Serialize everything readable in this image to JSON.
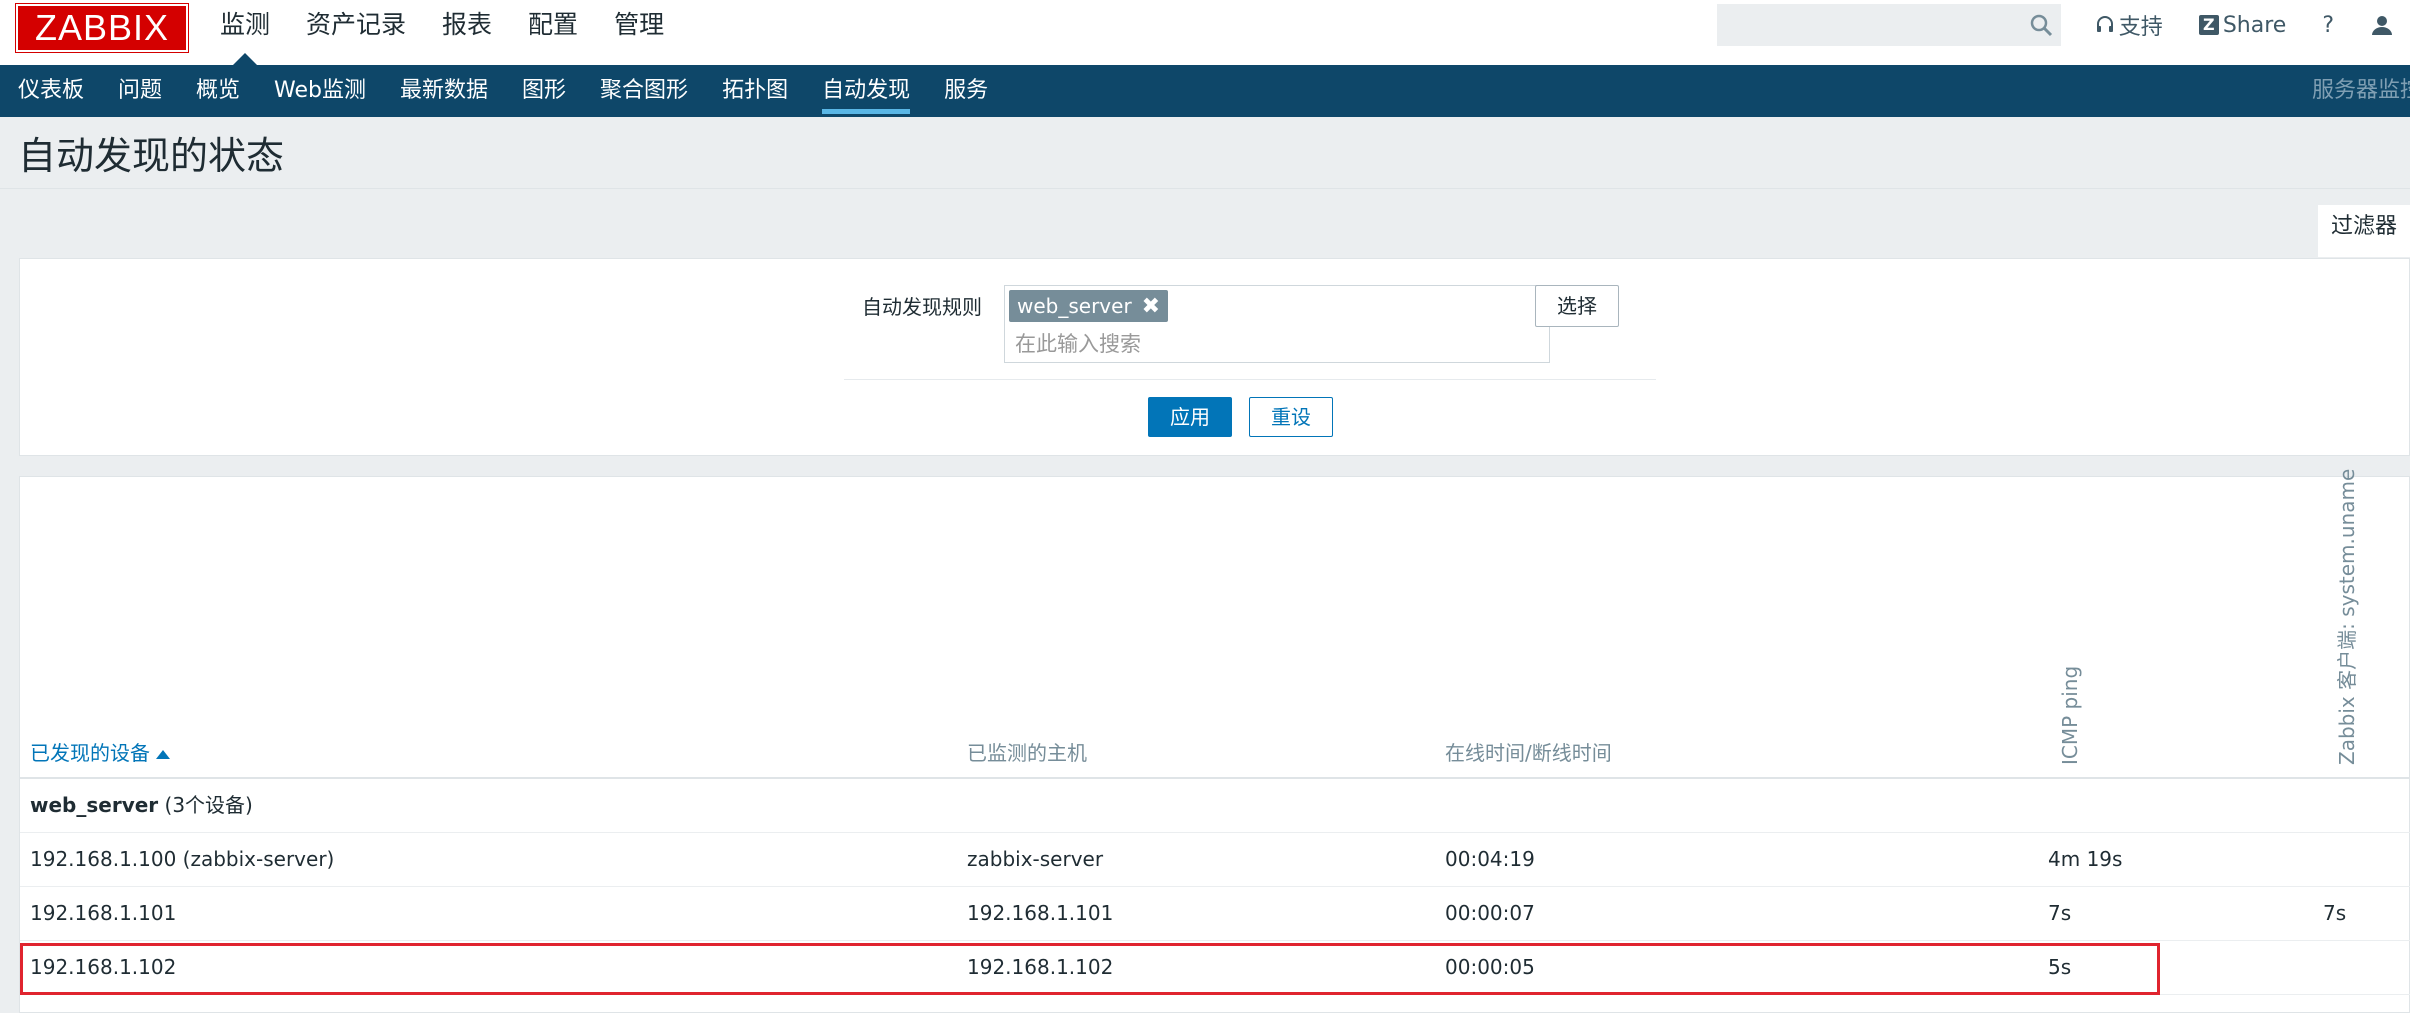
{
  "logo": "ZABBIX",
  "topnav": [
    "监测",
    "资产记录",
    "报表",
    "配置",
    "管理"
  ],
  "toplinks": {
    "support": "支持",
    "share": "Share",
    "help": "?"
  },
  "mainnav": [
    "仪表板",
    "问题",
    "概览",
    "Web监测",
    "最新数据",
    "图形",
    "聚合图形",
    "拓扑图",
    "自动发现",
    "服务"
  ],
  "mainnav_right": "服务器监控",
  "page_title": "自动发现的状态",
  "filter": {
    "tab_label": "过滤器",
    "rule_label": "自动发现规则",
    "tag": "web_server",
    "placeholder": "在此输入搜索",
    "select": "选择",
    "apply": "应用",
    "reset": "重设"
  },
  "table": {
    "headers": {
      "device": "已发现的设备",
      "host": "已监测的主机",
      "uptime": "在线时间/断线时间",
      "icmp": "ICMP ping",
      "agent": "Zabbix 客户端: system.uname"
    },
    "group": {
      "name": "web_server",
      "count": "(3个设备)"
    },
    "rows": [
      {
        "device": "192.168.1.100 (zabbix-server)",
        "host": "zabbix-server",
        "uptime": "00:04:19",
        "icmp": "4m 19s",
        "agent": ""
      },
      {
        "device": "192.168.1.101",
        "host": "192.168.1.101",
        "uptime": "00:00:07",
        "icmp": "7s",
        "agent": "7s"
      },
      {
        "device": "192.168.1.102",
        "host": "192.168.1.102",
        "uptime": "00:00:05",
        "icmp": "5s",
        "agent": ""
      }
    ]
  },
  "colors": {
    "brand_red": "#d40000",
    "nav_blue": "#0e4769",
    "link_blue": "#0275b8",
    "highlight_red": "#e0242f"
  }
}
